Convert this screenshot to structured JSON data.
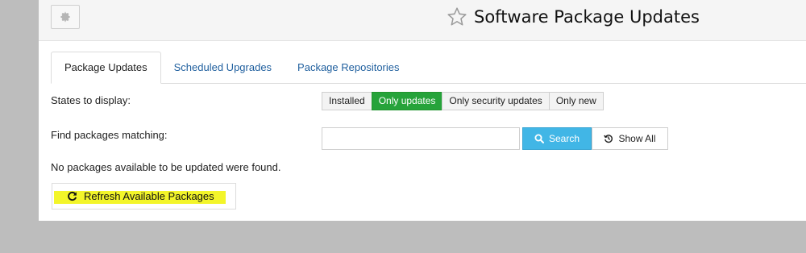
{
  "header": {
    "title": "Software Package Updates",
    "gear_icon": "gear-icon",
    "star_icon": "star-outline-icon"
  },
  "tabs": [
    {
      "label": "Package Updates",
      "active": true
    },
    {
      "label": "Scheduled Upgrades",
      "active": false
    },
    {
      "label": "Package Repositories",
      "active": false
    }
  ],
  "states": {
    "label": "States to display:",
    "options": [
      {
        "label": "Installed",
        "selected": false
      },
      {
        "label": "Only updates",
        "selected": true
      },
      {
        "label": "Only security updates",
        "selected": false
      },
      {
        "label": "Only new",
        "selected": false
      }
    ]
  },
  "find": {
    "label": "Find packages matching:",
    "value": "",
    "placeholder": "",
    "search_label": "Search",
    "show_all_label": "Show All"
  },
  "message": "No packages available to be updated were found.",
  "refresh": {
    "label": "Refresh Available Packages"
  },
  "colors": {
    "accent_green": "#26a33a",
    "search_blue": "#41b6e6",
    "link_blue": "#1f5f9e",
    "highlight_yellow": "#f3f52a"
  }
}
